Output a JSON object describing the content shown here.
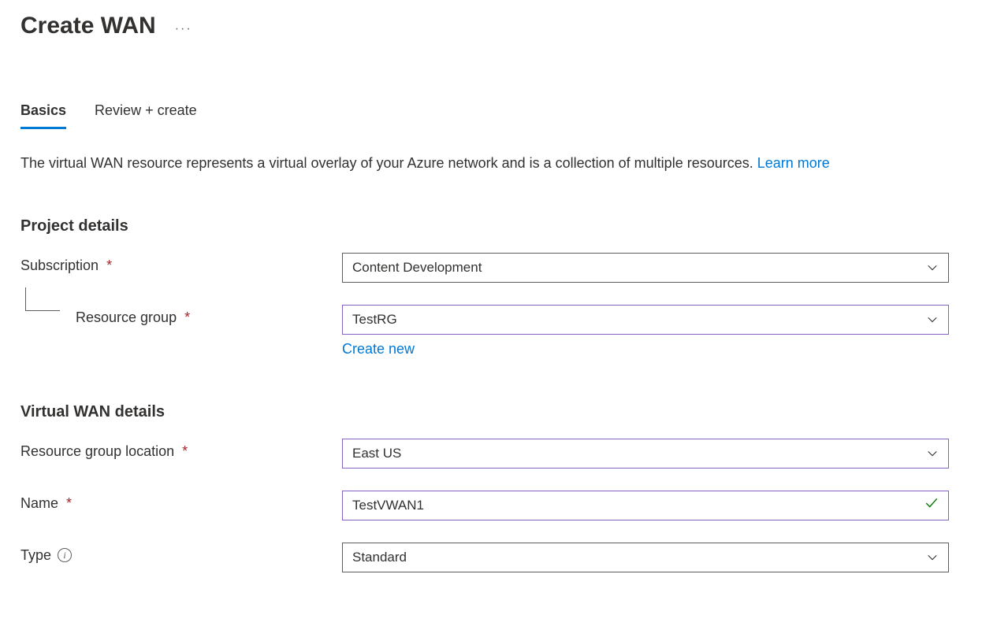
{
  "header": {
    "title": "Create WAN"
  },
  "tabs": {
    "basics": "Basics",
    "review_create": "Review + create"
  },
  "description": {
    "text": "The virtual WAN resource represents a virtual overlay of your Azure network and is a collection of multiple resources.  ",
    "link": "Learn more"
  },
  "sections": {
    "project_details": "Project details",
    "vwan_details": "Virtual WAN details"
  },
  "fields": {
    "subscription": {
      "label": "Subscription",
      "value": "Content Development"
    },
    "resource_group": {
      "label": "Resource group",
      "value": "TestRG",
      "create_new": "Create new"
    },
    "location": {
      "label": "Resource group location",
      "value": "East US"
    },
    "name": {
      "label": "Name",
      "value": "TestVWAN1"
    },
    "type": {
      "label": "Type",
      "value": "Standard"
    }
  }
}
